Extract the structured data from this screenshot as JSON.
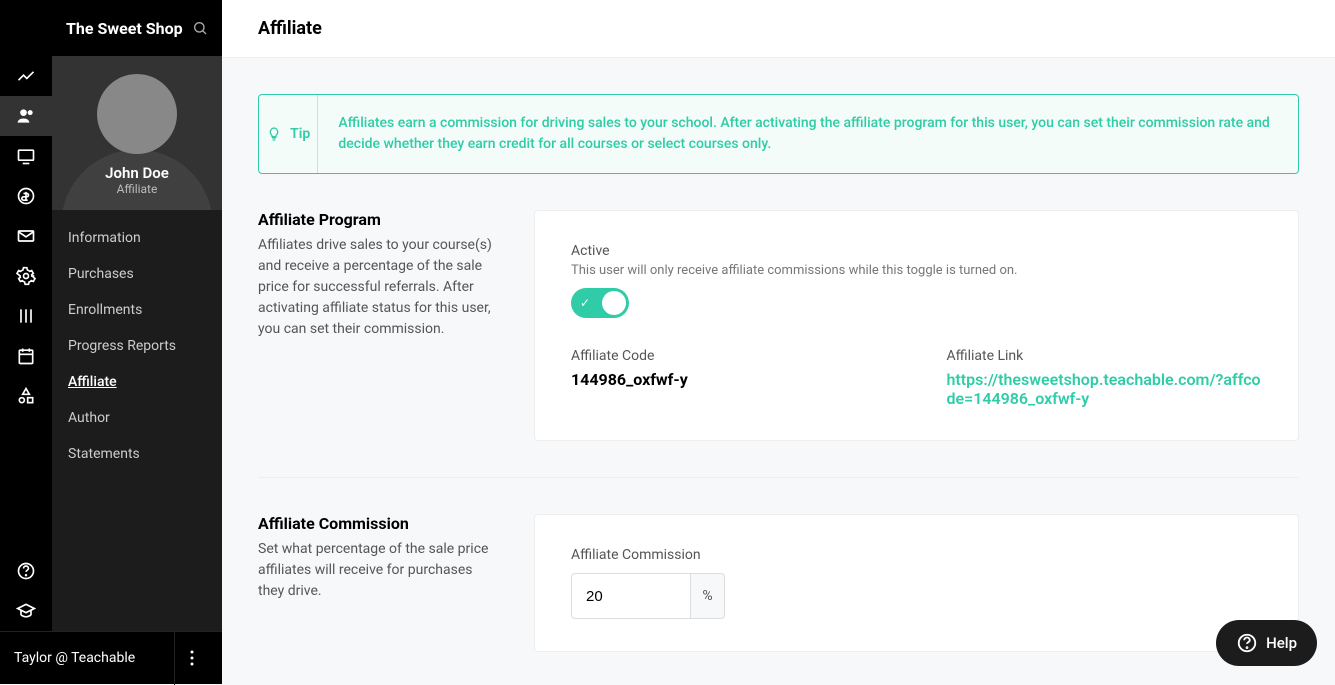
{
  "brand": "The Sweet Shop",
  "user": {
    "name": "John Doe",
    "role": "Affiliate"
  },
  "footer": {
    "name": "Taylor @ Teachable"
  },
  "page": {
    "title": "Affiliate"
  },
  "sidenav": {
    "items": [
      "Information",
      "Purchases",
      "Enrollments",
      "Progress Reports",
      "Affiliate",
      "Author",
      "Statements"
    ]
  },
  "tip": {
    "label": "Tip",
    "text": "Affiliates earn a commission for driving sales to your school. After activating the affiliate program for this user, you can set their commission rate and decide whether they earn credit for all courses or select courses only."
  },
  "section1": {
    "title": "Affiliate Program",
    "desc": "Affiliates drive sales to your course(s) and receive a percentage of the sale price for successful referrals. After activating affiliate status for this user, you can set their commission.",
    "active_label": "Active",
    "active_sub": "This user will only receive affiliate commissions while this toggle is turned on.",
    "code_label": "Affiliate Code",
    "code_value": "144986_oxfwf-y",
    "link_label": "Affiliate Link",
    "link_value": "https://thesweetshop.teachable.com/?affcode=144986_oxfwf-y"
  },
  "section2": {
    "title": "Affiliate Commission",
    "desc": "Set what percentage of the sale price affiliates will receive for purchases they drive.",
    "label": "Affiliate Commission",
    "value": "20",
    "suffix": "%"
  },
  "help": {
    "label": "Help"
  }
}
